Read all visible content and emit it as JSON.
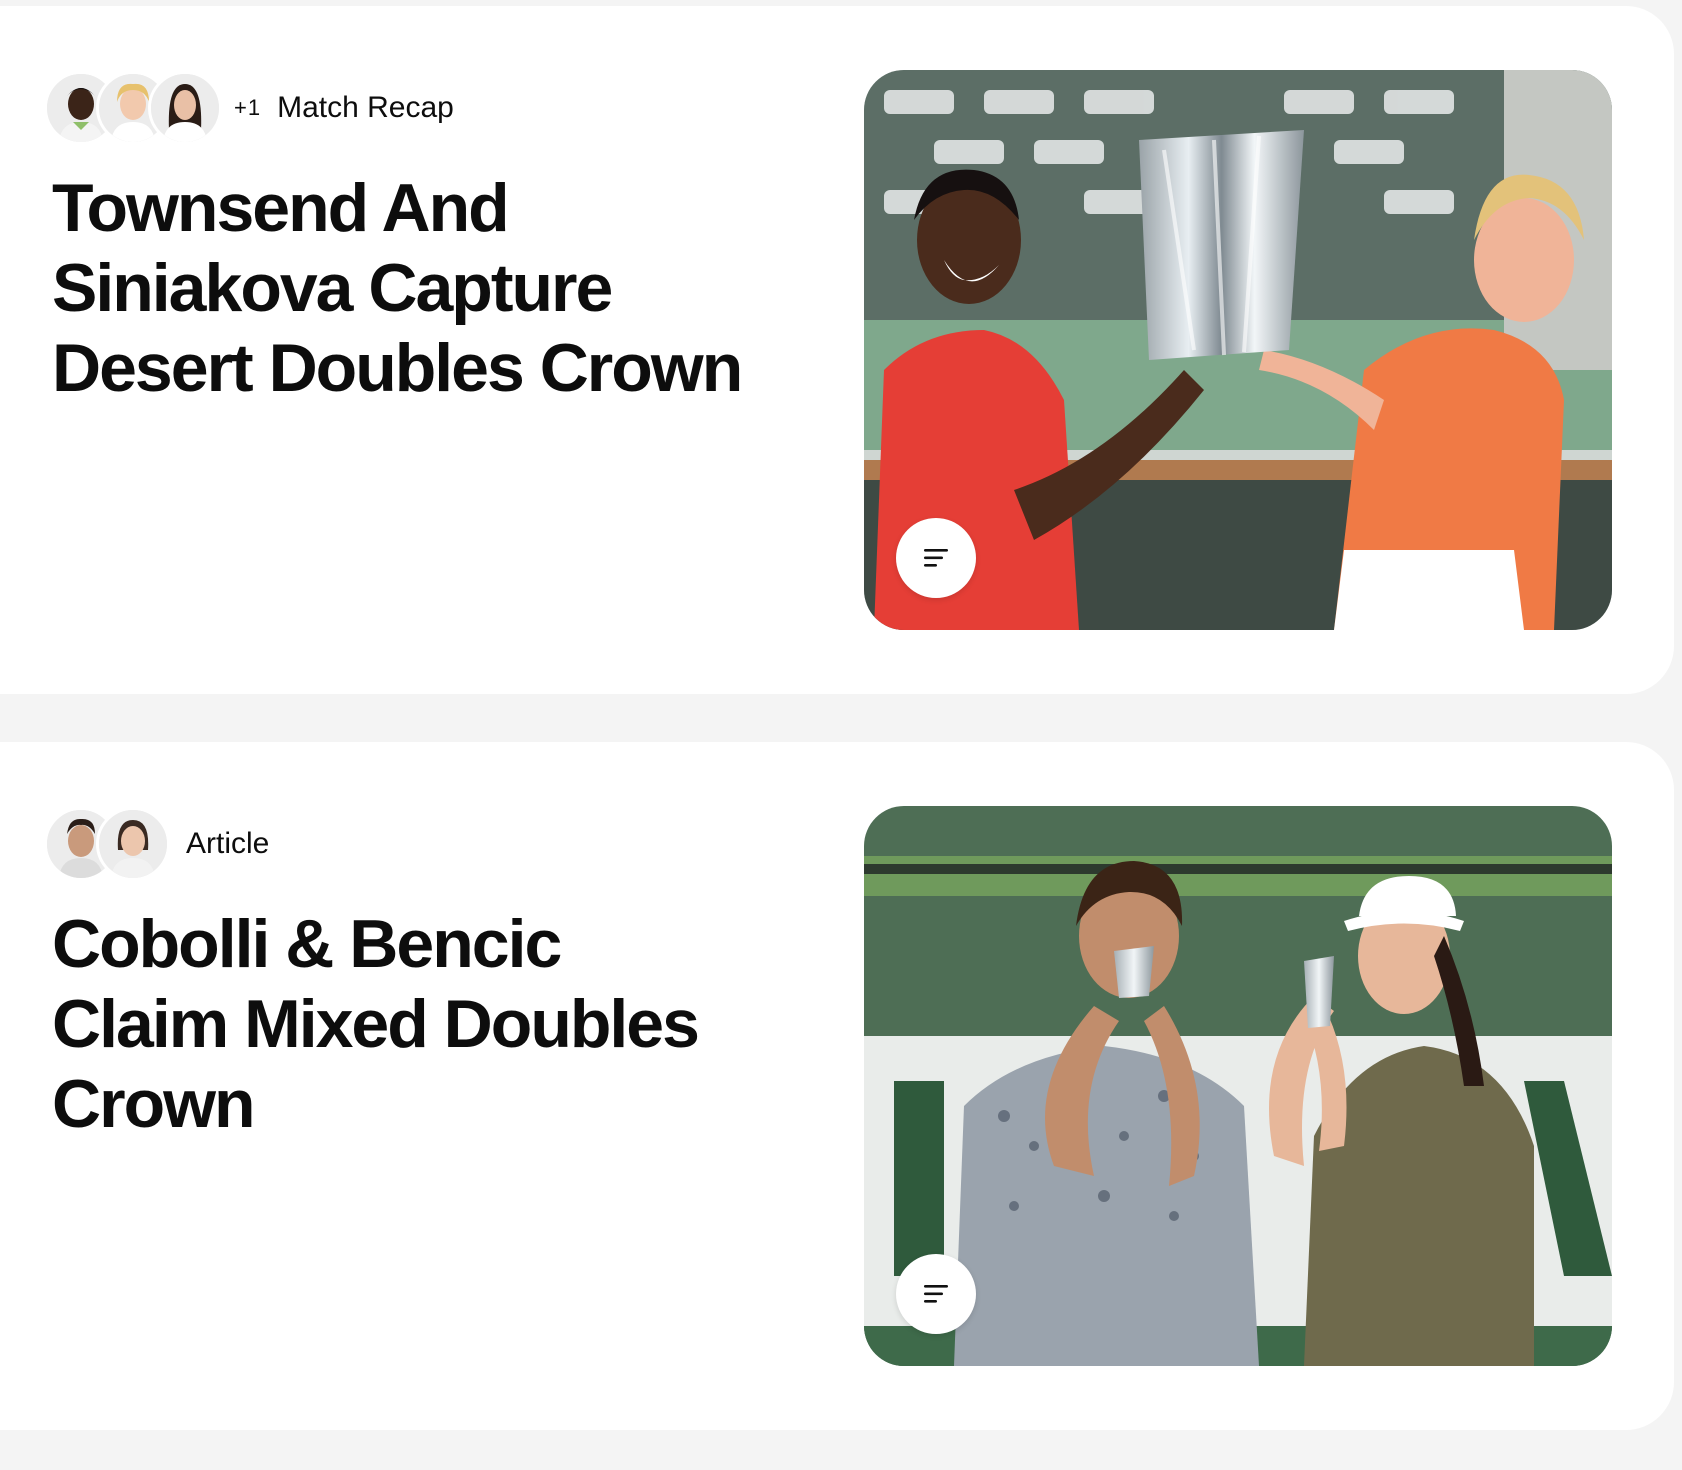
{
  "feed": {
    "items": [
      {
        "avatars": [
          "player-avatar",
          "player-avatar",
          "player-avatar"
        ],
        "extra_count": "+1",
        "content_type": "Match Recap",
        "title": "Townsend And Siniakova Capture Desert Doubles Crown",
        "image_icon": "menu-lines-icon"
      },
      {
        "avatars": [
          "player-avatar",
          "player-avatar"
        ],
        "content_type": "Article",
        "title": "Cobolli & Bencic Claim Mixed Doubles Crown",
        "image_icon": "menu-lines-icon"
      }
    ]
  },
  "colors": {
    "page_background": "#f4f4f4",
    "card_background": "#ffffff",
    "text": "#0d0d0d"
  }
}
